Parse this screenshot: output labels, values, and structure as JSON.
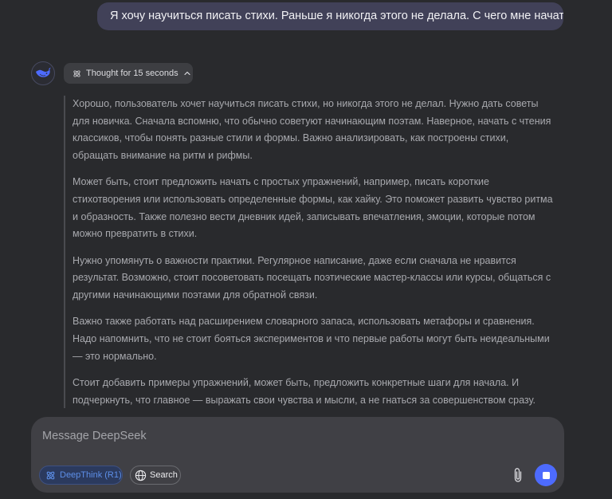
{
  "user_message": "Я хочу научиться писать стихи.  Раньше я никогда этого не делала. С чего мне начать?",
  "assistant": {
    "avatar_icon": "deepseek-whale-logo",
    "thought_label": "Thought for 15 seconds",
    "thought_icon": "atom-icon",
    "collapse_icon": "chevron-up-icon",
    "thinking_paragraphs": [
      "Хорошо, пользователь хочет научиться писать стихи, но никогда этого не делал. Нужно дать советы для новичка. Сначала вспомню, что обычно советуют начинающим поэтам. Наверное, начать с чтения классиков, чтобы понять разные стили и формы. Важно анализировать, как построены стихи, обращать внимание на ритм и рифмы.",
      "Может быть, стоит предложить начать с простых упражнений, например, писать короткие стихотворения или использовать определенные формы, как хайку. Это поможет развить чувство ритма и образность. Также полезно вести дневник идей, записывать впечатления, эмоции, которые потом можно превратить в стихи.",
      "Нужно упомянуть о важности практики. Регулярное написание, даже если сначала не нравится результат. Возможно, стоит посоветовать посещать поэтические мастер-классы или курсы, общаться с другими начинающими поэтами для обратной связи.",
      "Важно также работать над расширением словарного запаса, использовать метафоры и сравнения. Надо напомнить, что не стоит бояться экспериментов и что первые работы могут быть неидеальными — это нормально.",
      "Стоит добавить примеры упражнений, может быть, предложить конкретные шаги для начала. И подчеркнуть, что главное — выражать свои чувства и мысли, а не гнаться за совершенством сразу."
    ]
  },
  "composer": {
    "placeholder": "Message DeepSeek",
    "deepthink_label": "DeepThink (R1)",
    "deepthink_icon": "atom-icon",
    "search_label": "Search",
    "search_icon": "globe-icon",
    "attach_icon": "paperclip-icon",
    "stop_icon": "stop-icon"
  },
  "colors": {
    "background": "#292a2d",
    "user_bubble": "#414158",
    "accent": "#4d6bfe",
    "deepthink_text": "#5d8fe8"
  }
}
